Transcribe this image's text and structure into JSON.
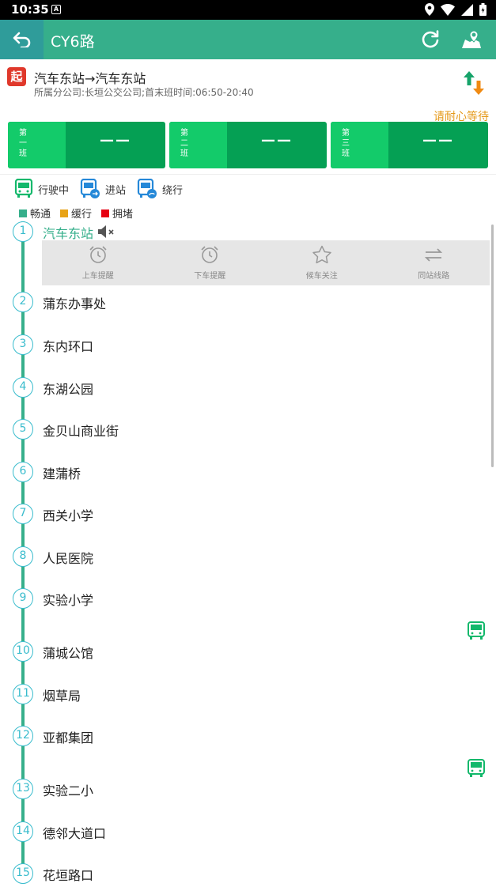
{
  "status": {
    "time": "10:35",
    "notif_letter": "A"
  },
  "appbar": {
    "title": "CY6路"
  },
  "route": {
    "start_badge": "起",
    "direction": "汽车东站→汽车东站",
    "company_info": "所属分公司:长垣公交公司;首末班时间:06:50-20:40",
    "wait_text": "请耐心等待"
  },
  "arrivals": [
    {
      "label": [
        "第",
        "一",
        "班"
      ],
      "value": "——"
    },
    {
      "label": [
        "第",
        "二",
        "班"
      ],
      "value": "——"
    },
    {
      "label": [
        "第",
        "三",
        "班"
      ],
      "value": "——"
    }
  ],
  "legend_bus": [
    {
      "label": "行驶中"
    },
    {
      "label": "进站"
    },
    {
      "label": "绕行"
    }
  ],
  "legend_traffic": [
    {
      "label": "畅通",
      "color": "#36af8b"
    },
    {
      "label": "缓行",
      "color": "#e8a317"
    },
    {
      "label": "拥堵",
      "color": "#e60012"
    }
  ],
  "station_actions": [
    {
      "label": "上车提醒",
      "icon": "alarm-icon"
    },
    {
      "label": "下车提醒",
      "icon": "alarm-icon"
    },
    {
      "label": "候车关注",
      "icon": "star-icon"
    },
    {
      "label": "同站线路",
      "icon": "transfer-icon"
    }
  ],
  "stations": [
    {
      "num": "1",
      "name": "汽车东站"
    },
    {
      "num": "2",
      "name": "蒲东办事处"
    },
    {
      "num": "3",
      "name": "东内环口"
    },
    {
      "num": "4",
      "name": "东湖公园"
    },
    {
      "num": "5",
      "name": "金贝山商业街"
    },
    {
      "num": "6",
      "name": "建蒲桥"
    },
    {
      "num": "7",
      "name": "西关小学"
    },
    {
      "num": "8",
      "name": "人民医院"
    },
    {
      "num": "9",
      "name": "实验小学"
    },
    {
      "num": "10",
      "name": "蒲城公馆"
    },
    {
      "num": "11",
      "name": "烟草局"
    },
    {
      "num": "12",
      "name": "亚都集团"
    },
    {
      "num": "13",
      "name": "实验二小"
    },
    {
      "num": "14",
      "name": "德邻大道口"
    },
    {
      "num": "15",
      "name": "花垣路口"
    }
  ],
  "colors": {
    "primary": "#36af8b",
    "accent_orange": "#e59a1b",
    "arrival_dark": "#05a054",
    "arrival_light": "#13cb6a"
  }
}
